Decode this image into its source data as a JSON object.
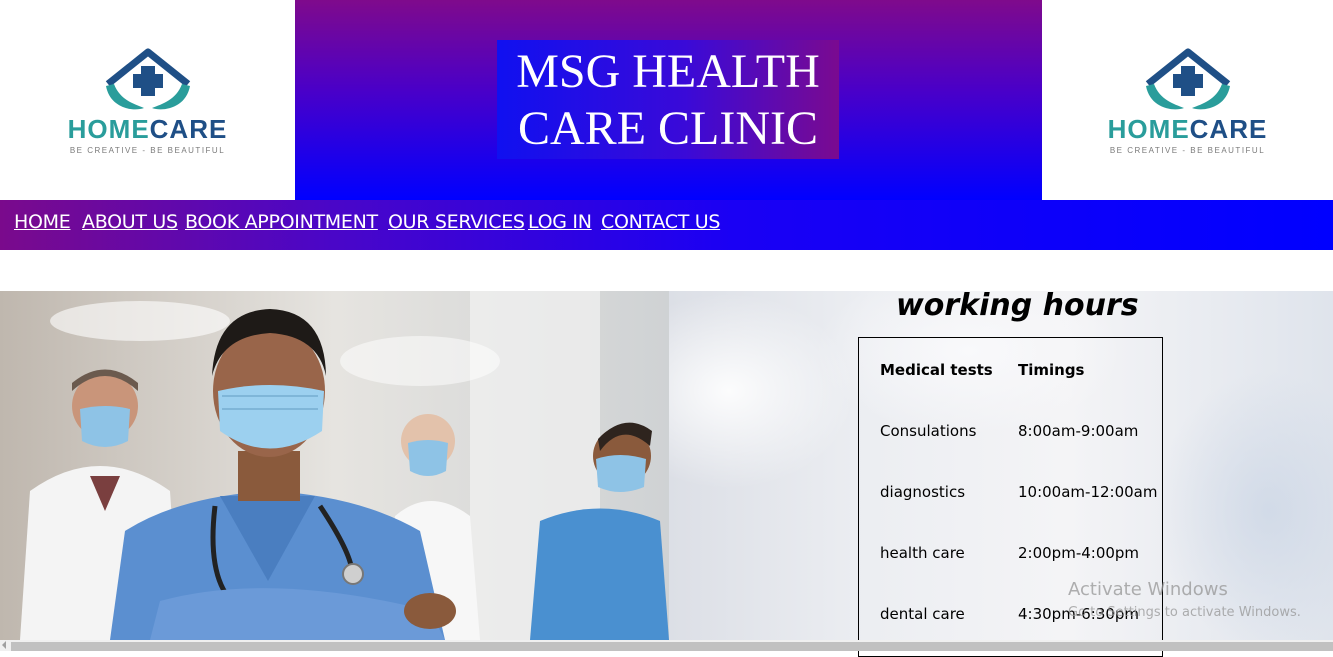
{
  "header": {
    "logo": {
      "word_part1": "HOME",
      "word_part2": "CARE",
      "tagline": "BE CREATIVE - BE BEAUTIFUL"
    },
    "title": "MSG HEALTH CARE CLINIC"
  },
  "nav": {
    "items": [
      {
        "label": "HOME"
      },
      {
        "label": "ABOUT US"
      },
      {
        "label": "BOOK APPOINTMENT"
      },
      {
        "label": "OUR SERVICES"
      },
      {
        "label": "LOG IN"
      },
      {
        "label": "CONTACT US"
      }
    ]
  },
  "working_hours": {
    "heading": "working hours",
    "columns": [
      "Medical tests",
      "Timings"
    ],
    "rows": [
      {
        "test": "Consulations",
        "time": "8:00am-9:00am"
      },
      {
        "test": "diagnostics",
        "time": "10:00am-12:00am"
      },
      {
        "test": "health care",
        "time": "2:00pm-4:00pm"
      },
      {
        "test": "dental care",
        "time": "4:30pm-6:30pm"
      }
    ]
  },
  "watermark": {
    "line1": "Activate Windows",
    "line2": "Go to Settings to activate Windows."
  },
  "colors": {
    "brand_teal": "#2a9d9b",
    "brand_navy": "#1f4f86",
    "header_purple": "#7f0a8c",
    "header_blue": "#0000ff"
  }
}
